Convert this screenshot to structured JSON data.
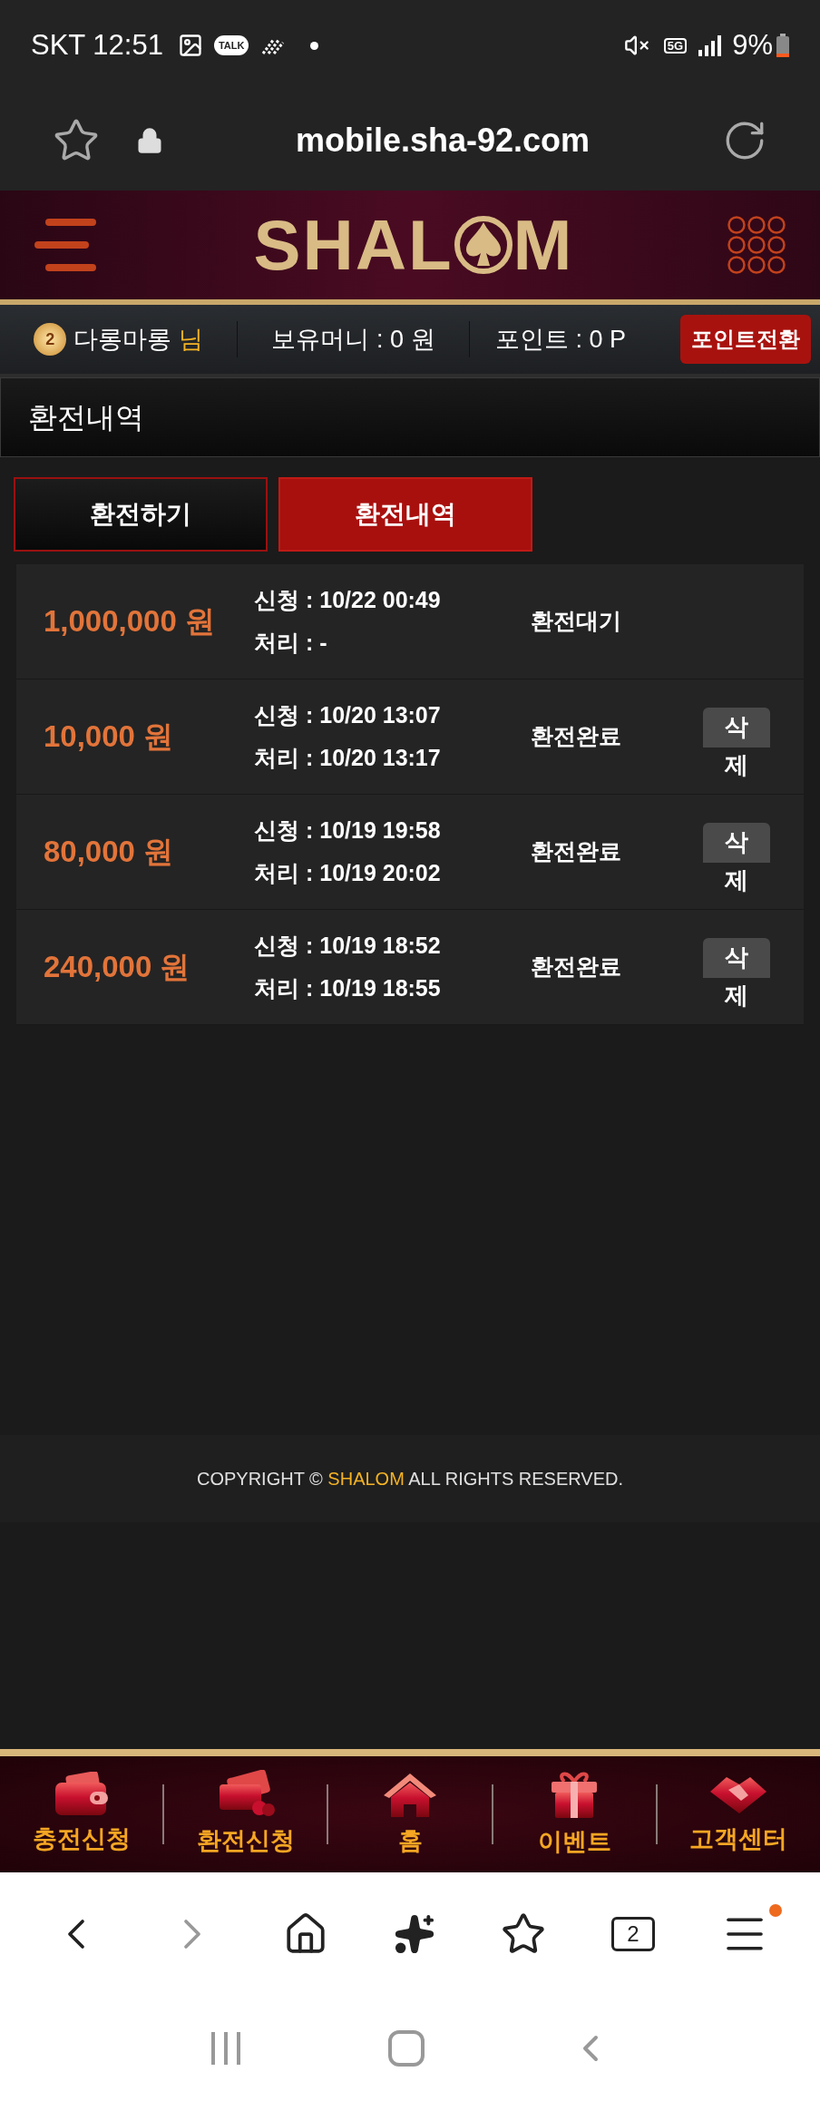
{
  "status_bar": {
    "carrier_time": "SKT 12:51",
    "talk_badge": "TALK",
    "network": "5G",
    "battery": "9%"
  },
  "browser": {
    "url": "mobile.sha-92.com",
    "tab_count": "2",
    "menu_badge": true
  },
  "header": {
    "logo_left": "SHAL",
    "logo_right": "M"
  },
  "user_bar": {
    "level": "2",
    "user": "다롱마롱",
    "honorific": "님",
    "money": "보유머니 : 0 원",
    "points": "포인트 : 0 P",
    "convert_button": "포인트전환"
  },
  "page_title": "환전내역",
  "tabs": [
    {
      "label": "환전하기",
      "selected": false
    },
    {
      "label": "환전내역",
      "selected": true
    }
  ],
  "rows": [
    {
      "amount": "1,000,000 원",
      "request_label": "신청 :",
      "request_time": "10/22 00:49",
      "process_label": "처리 :",
      "process_time": "-",
      "status": "환전대기"
    },
    {
      "amount": "10,000 원",
      "request_label": "신청 :",
      "request_time": "10/20 13:07",
      "process_label": "처리 :",
      "process_time": "10/20 13:17",
      "status": "환전완료",
      "delete_button": "삭제"
    },
    {
      "amount": "80,000 원",
      "request_label": "신청 :",
      "request_time": "10/19 19:58",
      "process_label": "처리 :",
      "process_time": "10/19 20:02",
      "status": "환전완료",
      "delete_button": "삭제"
    },
    {
      "amount": "240,000 원",
      "request_label": "신청 :",
      "request_time": "10/19 18:52",
      "process_label": "처리 :",
      "process_time": "10/19 18:55",
      "status": "환전완료",
      "delete_button": "삭제"
    }
  ],
  "footer": {
    "before": "COPYRIGHT ©",
    "brand": "SHALOM",
    "after": "ALL RIGHTS RESERVED."
  },
  "bottom_nav": [
    {
      "kind": "wallet",
      "label": "충전신청"
    },
    {
      "kind": "cash",
      "label": "환전신청"
    },
    {
      "kind": "home",
      "label": "홈"
    },
    {
      "kind": "gift",
      "label": "이벤트"
    },
    {
      "kind": "support",
      "label": "고객센터"
    }
  ]
}
